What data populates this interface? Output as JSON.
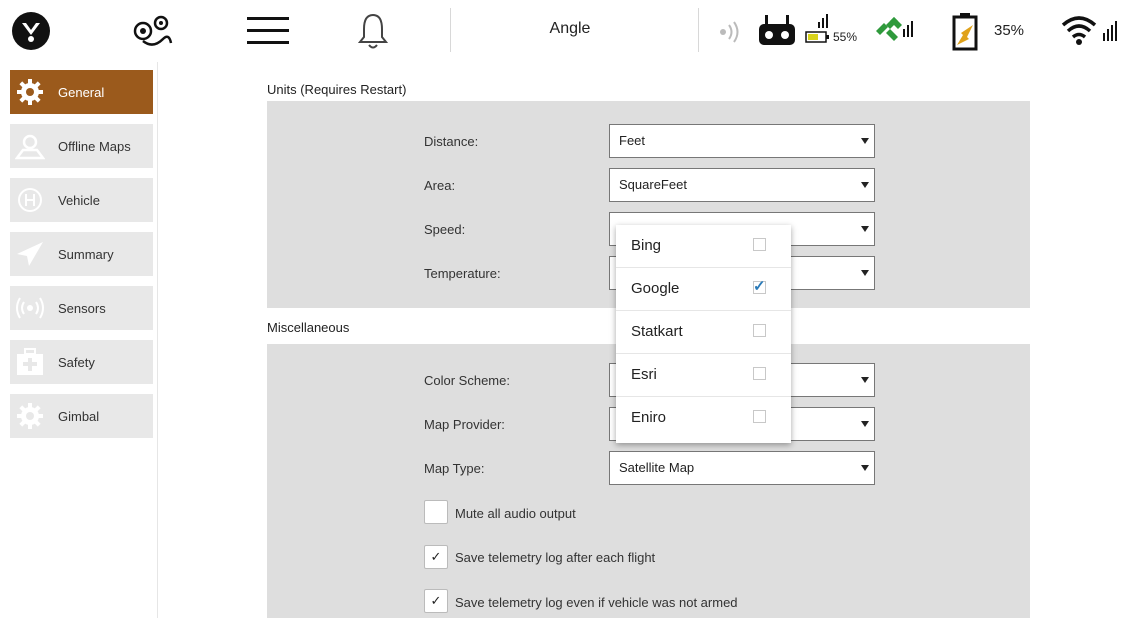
{
  "toolbar": {
    "flight_mode": "Angle",
    "vehicle_battery": "55%",
    "tablet_battery": "35%",
    "icons": [
      "logo-icon",
      "plan-view-icon",
      "menu-icon",
      "messages-bell-icon",
      "rc-signal-icon",
      "gamepad-icon",
      "vehicle-battery-icon",
      "gps-satellite-icon",
      "tablet-battery-icon",
      "wifi-icon"
    ]
  },
  "sidebar": {
    "items": [
      {
        "label": "General",
        "icon": "gear-icon",
        "active": true
      },
      {
        "label": "Offline Maps",
        "icon": "map-pin-icon",
        "active": false
      },
      {
        "label": "Vehicle",
        "icon": "vehicle-icon",
        "active": false
      },
      {
        "label": "Summary",
        "icon": "paper-plane-icon",
        "active": false
      },
      {
        "label": "Sensors",
        "icon": "sensor-icon",
        "active": false
      },
      {
        "label": "Safety",
        "icon": "first-aid-icon",
        "active": false
      },
      {
        "label": "Gimbal",
        "icon": "gear-icon",
        "active": false
      }
    ]
  },
  "units": {
    "title": "Units (Requires Restart)",
    "distance": {
      "label": "Distance:",
      "value": "Feet"
    },
    "area": {
      "label": "Area:",
      "value": "SquareFeet"
    },
    "speed": {
      "label": "Speed:",
      "value": ""
    },
    "temperature": {
      "label": "Temperature:",
      "value": ""
    }
  },
  "misc": {
    "title": "Miscellaneous",
    "color_scheme": {
      "label": "Color Scheme:",
      "value": ""
    },
    "map_provider": {
      "label": "Map Provider:",
      "value": ""
    },
    "map_type": {
      "label": "Map Type:",
      "value": "Satellite Map"
    },
    "mute_audio": {
      "label": "Mute all audio output",
      "checked": false
    },
    "save_log_after_flight": {
      "label": "Save telemetry log after each flight",
      "checked": true
    },
    "save_log_not_armed": {
      "label": "Save telemetry log even if vehicle was not armed",
      "checked": true
    }
  },
  "map_provider_popup": {
    "options": [
      {
        "label": "Bing",
        "checked": false
      },
      {
        "label": "Google",
        "checked": true
      },
      {
        "label": "Statkart",
        "checked": false
      },
      {
        "label": "Esri",
        "checked": false
      },
      {
        "label": "Eniro",
        "checked": false
      }
    ]
  },
  "check_glyph": "✓",
  "colors": {
    "accent": "#9b5a1c",
    "panel": "#dedede",
    "sidebar_item": "#e8e8e8",
    "check": "#2a7ab8"
  }
}
